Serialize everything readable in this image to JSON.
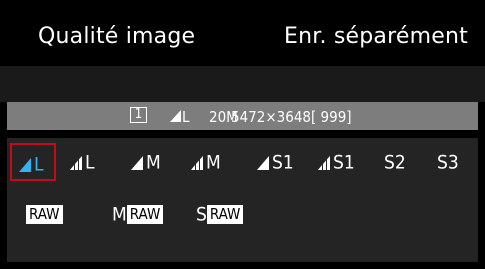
{
  "header": {
    "title": "Qualité image",
    "value": "Enr. séparément"
  },
  "info_bar": {
    "card_number": "1",
    "quality": "L",
    "megapixels": "20M",
    "resolution": "5472×3648",
    "shots": "[ 999]"
  },
  "options": {
    "row1": [
      {
        "label": "L",
        "icon": "fine-quality-icon",
        "selected": true
      },
      {
        "label": "L",
        "icon": "normal-quality-icon",
        "selected": false
      },
      {
        "label": "M",
        "icon": "fine-quality-icon",
        "selected": false
      },
      {
        "label": "M",
        "icon": "normal-quality-icon",
        "selected": false
      },
      {
        "label": "S1",
        "icon": "fine-quality-icon",
        "selected": false
      },
      {
        "label": "S1",
        "icon": "normal-quality-icon",
        "selected": false
      },
      {
        "label": "S2",
        "icon": "",
        "selected": false
      },
      {
        "label": "S3",
        "icon": "",
        "selected": false
      }
    ],
    "row2": [
      {
        "prefix": "",
        "chip": "RAW"
      },
      {
        "prefix": "M",
        "chip": "RAW"
      },
      {
        "prefix": "S",
        "chip": "RAW"
      }
    ]
  },
  "colors": {
    "selected_text": "#35b5f0",
    "selection_border": "#c50a1c",
    "info_bar": "#7d7d7d",
    "panel": "#242424"
  }
}
